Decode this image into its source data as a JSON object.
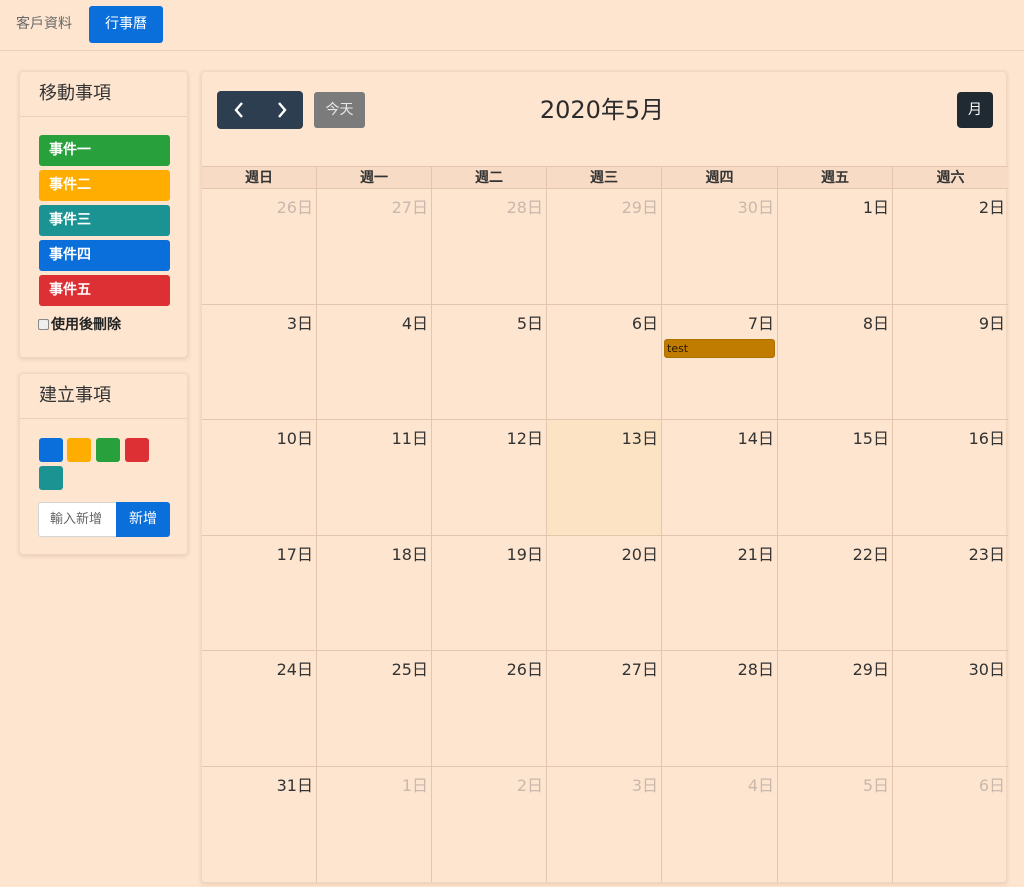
{
  "nav": {
    "items": [
      {
        "label": "客戶資料"
      },
      {
        "label": "行事曆"
      }
    ]
  },
  "sidebar": {
    "move_title": "移動事項",
    "external_events": [
      {
        "label": "事件一",
        "color": "#28a03c"
      },
      {
        "label": "事件二",
        "color": "#ffad00"
      },
      {
        "label": "事件三",
        "color": "#1b9393"
      },
      {
        "label": "事件四",
        "color": "#0b6fdb"
      },
      {
        "label": "事件五",
        "color": "#dc3035"
      }
    ],
    "remove_after_use_label": "使用後刪除",
    "create_title": "建立事項",
    "swatches": [
      "#0b6fdb",
      "#ffad00",
      "#28a03c",
      "#dc3035",
      "#1b9393"
    ],
    "new_event_placeholder": "輸入新增",
    "add_label": "新增"
  },
  "calendar": {
    "title": "2020年5月",
    "today_label": "今天",
    "month_label": "月",
    "weekdays": [
      "週日",
      "週一",
      "週二",
      "週三",
      "週四",
      "週五",
      "週六"
    ],
    "days": [
      "26日",
      "27日",
      "28日",
      "29日",
      "30日",
      "1日",
      "2日",
      "3日",
      "4日",
      "5日",
      "6日",
      "7日",
      "8日",
      "9日",
      "10日",
      "11日",
      "12日",
      "13日",
      "14日",
      "15日",
      "16日",
      "17日",
      "18日",
      "19日",
      "20日",
      "21日",
      "22日",
      "23日",
      "24日",
      "25日",
      "26日",
      "27日",
      "28日",
      "29日",
      "30日",
      "31日",
      "1日",
      "2日",
      "3日",
      "4日",
      "5日",
      "6日"
    ],
    "event": {
      "title": "test",
      "color": "#c07c00"
    }
  }
}
